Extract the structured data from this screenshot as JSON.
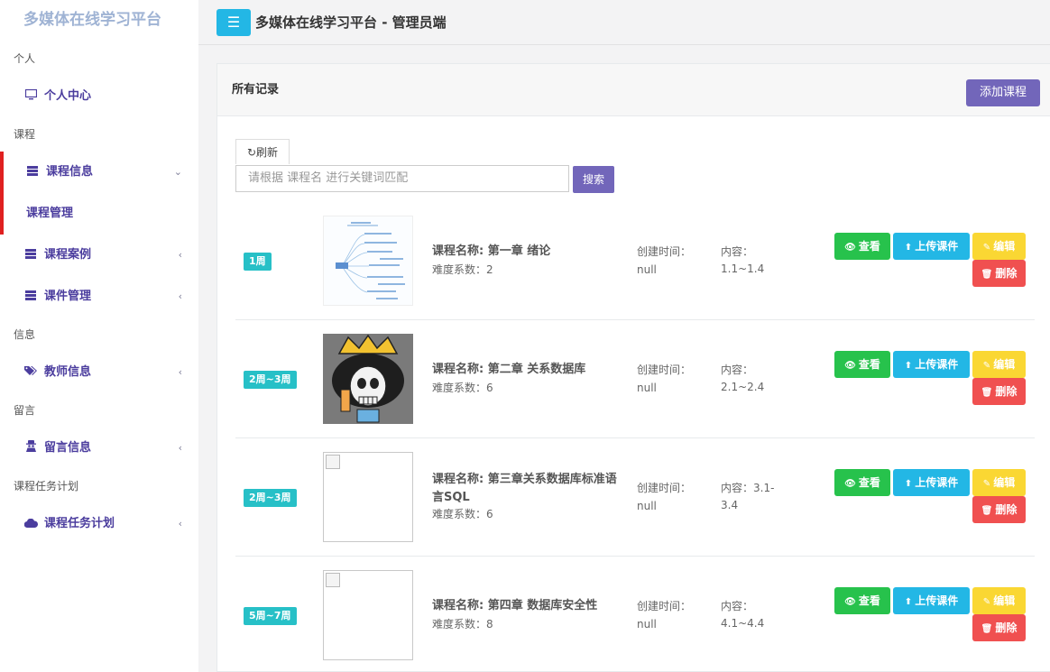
{
  "sidebar": {
    "brand": "多媒体在线学习平台",
    "sections": {
      "personal": "个人",
      "course": "课程",
      "info": "信息",
      "message": "留言",
      "plan": "课程任务计划"
    },
    "items": {
      "profile": "个人中心",
      "course_info": "课程信息",
      "course_manage": "课程管理",
      "course_case": "课程案例",
      "courseware": "课件管理",
      "teacher_info": "教师信息",
      "message_info": "留言信息",
      "course_plan": "课程任务计划"
    },
    "icons": {
      "profile": "monitor-icon",
      "course_info": "server-icon",
      "course_case": "server-icon",
      "courseware": "server-icon",
      "teacher_info": "tags-icon",
      "message_info": "user-secret-icon",
      "course_plan": "cloud-icon"
    }
  },
  "header": {
    "menu_icon": "hamburger-icon",
    "title": "多媒体在线学习平台 - 管理员端"
  },
  "panel": {
    "title": "所有记录",
    "add_button": "添加课程",
    "refresh": "刷新",
    "search_placeholder": "请根据 课程名 进行关键词匹配",
    "search_button": "搜索"
  },
  "labels": {
    "created": "创建时间：",
    "view": "查看",
    "upload": "上传课件",
    "edit": "编辑",
    "delete": "删除"
  },
  "courses": [
    {
      "week": "1周",
      "name": "课程名称: 第一章 绪论",
      "difficulty": "难度系数：2",
      "created": "null",
      "content_label": "内容：",
      "content": "1.1~1.4",
      "thumb": "mindmap"
    },
    {
      "week": "2周~3周",
      "name": "课程名称: 第二章 关系数据库",
      "difficulty": "难度系数：6",
      "created": "null",
      "content_label": "内容：",
      "content": "2.1~2.4",
      "thumb": "cartoon"
    },
    {
      "week": "2周~3周",
      "name": "课程名称: 第三章关系数据库标准语言SQL",
      "difficulty": "难度系数：6",
      "created": "null",
      "content_label": "内容：3.1-",
      "content": "3.4",
      "thumb": "broken"
    },
    {
      "week": "5周~7周",
      "name": "课程名称: 第四章 数据库安全性",
      "difficulty": "难度系数：8",
      "created": "null",
      "content_label": "内容：",
      "content": "4.1~4.4",
      "thumb": "broken"
    }
  ],
  "colors": {
    "accent": "#7266ba",
    "info": "#23b7e5",
    "success": "#27c24c",
    "warning": "#fad733",
    "danger": "#f05050",
    "badge": "#27c0c7",
    "active_marker": "#e02020"
  }
}
